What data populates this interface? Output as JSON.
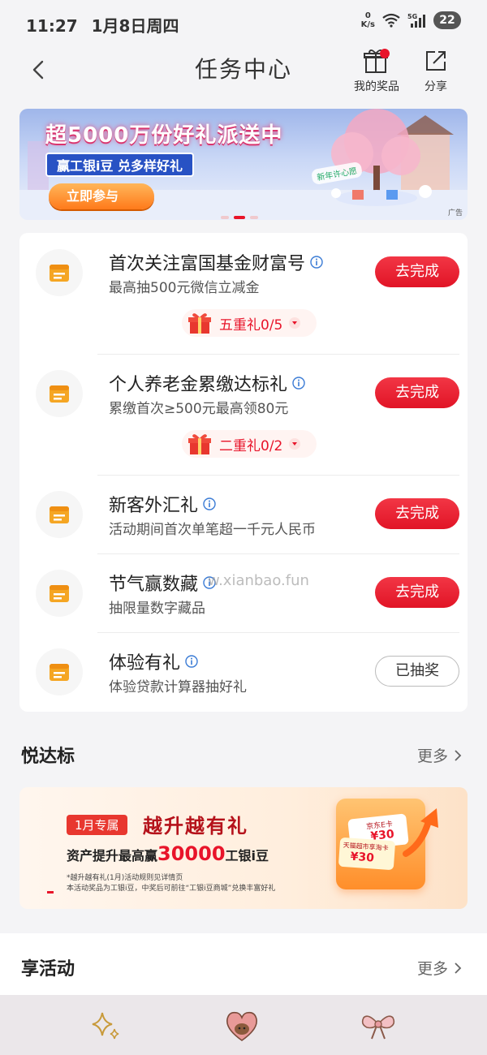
{
  "status_bar": {
    "time": "11:27",
    "date": "1月8日周四",
    "net_speed_value": "0",
    "net_speed_unit": "K/s",
    "battery": "22"
  },
  "header": {
    "title": "任务中心",
    "prizes_label": "我的奖品",
    "share_label": "分享"
  },
  "banner": {
    "title": "超5000万份好礼派送中",
    "subtitle": "赢工银i豆 兑多样好礼",
    "button": "立即参与",
    "tag": "新年许心愿",
    "ad_label": "广告"
  },
  "tasks": [
    {
      "title": "首次关注富国基金财富号",
      "desc": "最高抽500元微信立减金",
      "button": "去完成",
      "tier": "五重礼0/5"
    },
    {
      "title": "个人养老金累缴达标礼",
      "desc": "累缴首次≥500元最高领80元",
      "button": "去完成",
      "tier": "二重礼0/2"
    },
    {
      "title": "新客外汇礼",
      "desc": "活动期间首次单笔超一千元人民币",
      "button": "去完成"
    },
    {
      "title": "节气赢数藏",
      "desc": "抽限量数字藏品",
      "button": "去完成"
    },
    {
      "title": "体验有礼",
      "desc": "体验贷款计算器抽好礼",
      "button": "已抽奖"
    }
  ],
  "watermark": "w.xianbao.fun",
  "section_yuedabiao": {
    "title": "悦达标",
    "more": "更多"
  },
  "promo": {
    "tag": "1月专属",
    "title": "越升越有礼",
    "line_prefix": "资产提升最高赢",
    "line_number": "30000",
    "line_suffix": "工银i豆",
    "note1": "*越升越有礼(1月)活动规则见详情页",
    "note2": "本活动奖品为工银i豆，中奖后可前往“工银i豆商城”兑换丰富好礼",
    "card1_name": "京东E卡",
    "card1_value": "¥30",
    "card2_name": "天猫超市享淘卡",
    "card2_value": "¥30"
  },
  "section_activity": {
    "title": "享活动",
    "more": "更多"
  },
  "colors": {
    "accent_red": "#e8142a",
    "task_icon_orange": "#f5a623"
  }
}
